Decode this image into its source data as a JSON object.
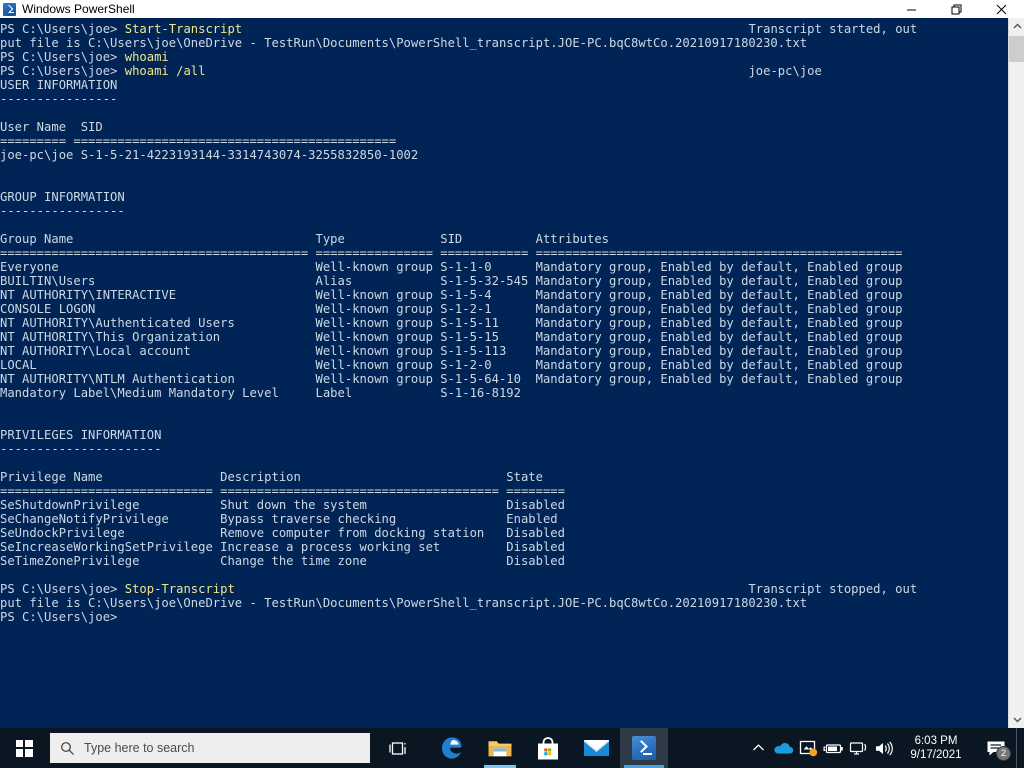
{
  "window": {
    "title": "Windows PowerShell",
    "icon": "powershell-icon",
    "background_color": "#012456",
    "text_color": "#ccd8e4",
    "command_color": "#f0e68c",
    "buttons": {
      "minimize": "minimize-icon",
      "maximize": "restore-icon",
      "close": "close-icon"
    }
  },
  "console": {
    "prompt": "PS C:\\Users\\joe>",
    "columns": 122,
    "lines": [
      {
        "type": "prompt",
        "prompt": "PS C:\\Users\\joe> ",
        "command": "Start-Transcript",
        "pad_to": 102,
        "tail": "Transcript started, out"
      },
      {
        "type": "plain",
        "text": "put file is C:\\Users\\joe\\OneDrive - TestRun\\Documents\\PowerShell_transcript.JOE-PC.bqC8wtCo.20210917180230.txt"
      },
      {
        "type": "prompt",
        "prompt": "PS C:\\Users\\joe> ",
        "command": "whoami",
        "pad_to": 102,
        "tail": ""
      },
      {
        "type": "prompt",
        "prompt": "PS C:\\Users\\joe> ",
        "command": "whoami /all",
        "pad_to": 102,
        "tail": "joe-pc\\joe"
      },
      {
        "type": "plain",
        "text": "USER INFORMATION"
      },
      {
        "type": "plain",
        "text": "----------------"
      },
      {
        "type": "plain",
        "text": ""
      },
      {
        "type": "plain",
        "text": "User Name  SID"
      },
      {
        "type": "plain",
        "text": "========= ============================================"
      },
      {
        "type": "plain",
        "text": "joe-pc\\joe S-1-5-21-4223193144-3314743074-3255832850-1002"
      },
      {
        "type": "plain",
        "text": ""
      },
      {
        "type": "plain",
        "text": ""
      },
      {
        "type": "plain",
        "text": "GROUP INFORMATION"
      },
      {
        "type": "plain",
        "text": "-----------------"
      },
      {
        "type": "plain",
        "text": ""
      },
      {
        "type": "plain",
        "text": "Group Name                                 Type             SID          Attributes"
      },
      {
        "type": "plain",
        "text": "========================================== ================ ============ =================================================="
      },
      {
        "type": "plain",
        "text": "Everyone                                   Well-known group S-1-1-0      Mandatory group, Enabled by default, Enabled group"
      },
      {
        "type": "plain",
        "text": "BUILTIN\\Users                              Alias            S-1-5-32-545 Mandatory group, Enabled by default, Enabled group"
      },
      {
        "type": "plain",
        "text": "NT AUTHORITY\\INTERACTIVE                   Well-known group S-1-5-4      Mandatory group, Enabled by default, Enabled group"
      },
      {
        "type": "plain",
        "text": "CONSOLE LOGON                              Well-known group S-1-2-1      Mandatory group, Enabled by default, Enabled group"
      },
      {
        "type": "plain",
        "text": "NT AUTHORITY\\Authenticated Users           Well-known group S-1-5-11     Mandatory group, Enabled by default, Enabled group"
      },
      {
        "type": "plain",
        "text": "NT AUTHORITY\\This Organization             Well-known group S-1-5-15     Mandatory group, Enabled by default, Enabled group"
      },
      {
        "type": "plain",
        "text": "NT AUTHORITY\\Local account                 Well-known group S-1-5-113    Mandatory group, Enabled by default, Enabled group"
      },
      {
        "type": "plain",
        "text": "LOCAL                                      Well-known group S-1-2-0      Mandatory group, Enabled by default, Enabled group"
      },
      {
        "type": "plain",
        "text": "NT AUTHORITY\\NTLM Authentication           Well-known group S-1-5-64-10  Mandatory group, Enabled by default, Enabled group"
      },
      {
        "type": "plain",
        "text": "Mandatory Label\\Medium Mandatory Level     Label            S-1-16-8192"
      },
      {
        "type": "plain",
        "text": ""
      },
      {
        "type": "plain",
        "text": ""
      },
      {
        "type": "plain",
        "text": "PRIVILEGES INFORMATION"
      },
      {
        "type": "plain",
        "text": "----------------------"
      },
      {
        "type": "plain",
        "text": ""
      },
      {
        "type": "plain",
        "text": "Privilege Name                Description                            State"
      },
      {
        "type": "plain",
        "text": "============================= ====================================== ========"
      },
      {
        "type": "plain",
        "text": "SeShutdownPrivilege           Shut down the system                   Disabled"
      },
      {
        "type": "plain",
        "text": "SeChangeNotifyPrivilege       Bypass traverse checking               Enabled"
      },
      {
        "type": "plain",
        "text": "SeUndockPrivilege             Remove computer from docking station   Disabled"
      },
      {
        "type": "plain",
        "text": "SeIncreaseWorkingSetPrivilege Increase a process working set         Disabled"
      },
      {
        "type": "plain",
        "text": "SeTimeZonePrivilege           Change the time zone                   Disabled"
      },
      {
        "type": "plain",
        "text": ""
      },
      {
        "type": "prompt",
        "prompt": "PS C:\\Users\\joe> ",
        "command": "Stop-Transcript",
        "pad_to": 102,
        "tail": "Transcript stopped, out"
      },
      {
        "type": "plain",
        "text": "put file is C:\\Users\\joe\\OneDrive - TestRun\\Documents\\PowerShell_transcript.JOE-PC.bqC8wtCo.20210917180230.txt"
      },
      {
        "type": "prompt",
        "prompt": "PS C:\\Users\\joe>",
        "command": "",
        "pad_to": 0,
        "tail": ""
      }
    ]
  },
  "scrollbar": {
    "up_arrow": "chevron-up-icon",
    "down_arrow": "chevron-down-icon"
  },
  "taskbar": {
    "start_label": "windows-logo",
    "search": {
      "placeholder": "Type here to search",
      "icon": "search-icon"
    },
    "task_view": "task-view-icon",
    "apps": [
      {
        "name": "edge",
        "label": "Microsoft Edge",
        "state": "idle"
      },
      {
        "name": "file-explorer",
        "label": "File Explorer",
        "state": "open"
      },
      {
        "name": "microsoft-store",
        "label": "Microsoft Store",
        "state": "idle"
      },
      {
        "name": "mail",
        "label": "Mail",
        "state": "idle"
      },
      {
        "name": "powershell",
        "label": "Windows PowerShell",
        "state": "active"
      }
    ],
    "tray": [
      {
        "name": "show-hidden-icons",
        "icon": "chevron-up-icon"
      },
      {
        "name": "onedrive",
        "icon": "cloud-icon"
      },
      {
        "name": "onedrive-sync-warning",
        "icon": "sync-warning-icon"
      },
      {
        "name": "battery",
        "icon": "battery-icon"
      },
      {
        "name": "network",
        "icon": "network-icon"
      },
      {
        "name": "volume",
        "icon": "speaker-icon"
      }
    ],
    "clock": {
      "time": "6:03 PM",
      "date": "9/17/2021"
    },
    "notifications": {
      "icon": "notification-icon",
      "count": "2"
    }
  }
}
